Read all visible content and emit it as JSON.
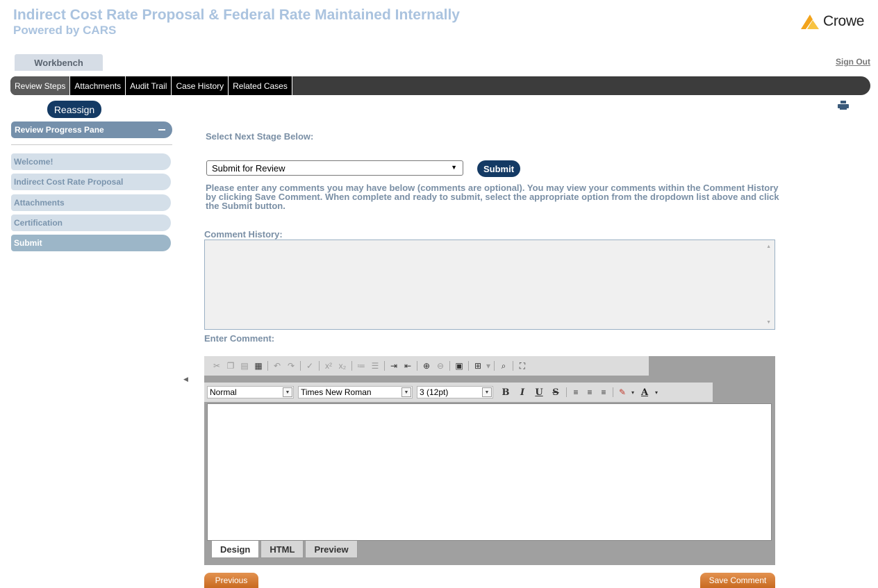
{
  "header": {
    "title": "Indirect Cost Rate Proposal & Federal Rate Maintained Internally",
    "subtitle": "Powered by CARS",
    "logo_text": "Crowe",
    "workbench_tab": "Workbench",
    "sign_out": "Sign Out"
  },
  "tabs": [
    {
      "label": "Review Steps",
      "active": true
    },
    {
      "label": "Attachments"
    },
    {
      "label": "Audit Trail"
    },
    {
      "label": "Case History"
    },
    {
      "label": "Related Cases"
    }
  ],
  "sidebar": {
    "reassign_label": "Reassign",
    "pane_title": "Review Progress Pane",
    "steps": [
      {
        "label": "Welcome!"
      },
      {
        "label": "Indirect Cost Rate Proposal"
      },
      {
        "label": "Attachments"
      },
      {
        "label": "Certification"
      },
      {
        "label": "Submit",
        "current": true
      }
    ]
  },
  "main": {
    "select_stage_label": "Select Next Stage Below:",
    "stage_select_value": "Submit for Review",
    "submit_label": "Submit",
    "instructions": "Please enter any comments you may have below (comments are optional). You may view your comments within the Comment History by clicking Save Comment. When complete and ready to submit, select the appropriate option from the dropdown list above and click the Submit button.",
    "comment_history_label": "Comment History:",
    "enter_comment_label": "Enter Comment:",
    "editor": {
      "paragraph_style": "Normal",
      "font_name": "Times New Roman",
      "font_size": "3 (12pt)",
      "mode_tabs": [
        "Design",
        "HTML",
        "Preview"
      ]
    },
    "previous_label": "Previous",
    "save_comment_label": "Save Comment"
  },
  "colors": {
    "accent_navy": "#143a64",
    "title_blue": "#aac3df",
    "orange_button": "#d77a35"
  }
}
